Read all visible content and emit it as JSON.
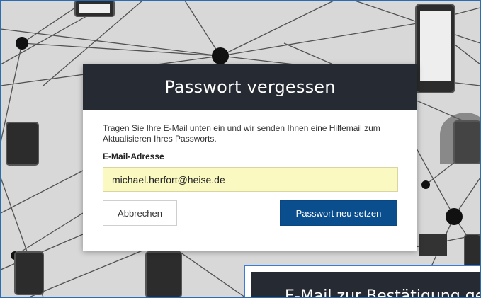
{
  "modal": {
    "title": "Passwort vergessen",
    "instructions": "Tragen Sie Ihre E-Mail unten ein und wir senden Ihnen eine Hilfemail zum Aktualisieren Ihres Passworts.",
    "email_label": "E-Mail-Adresse",
    "email_value": "michael.herfort@heise.de",
    "cancel_label": "Abbrechen",
    "submit_label": "Passwort neu setzen"
  },
  "second_modal": {
    "title": "E-Mail zur Bestätigung ge"
  },
  "colors": {
    "header_bg": "#262a33",
    "primary_button": "#0b4e8e",
    "input_bg": "#fbf9c2",
    "frame_border": "#2a6db5"
  },
  "background": {
    "description_icon": "network-devices-illustration"
  }
}
